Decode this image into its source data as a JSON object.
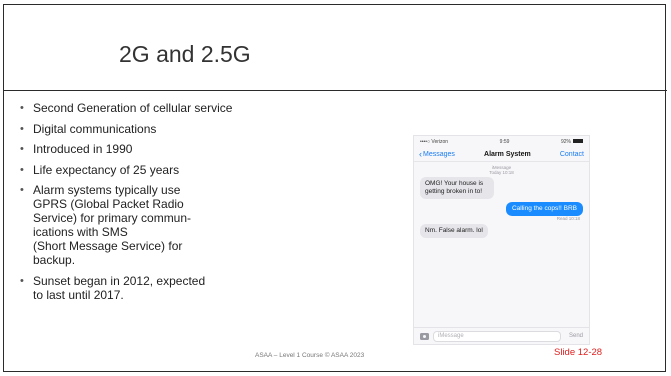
{
  "slide": {
    "title": "2G and 2.5G",
    "bullets": [
      "Second Generation of cellular service",
      "Digital communications",
      "Introduced in 1990",
      "Life expectancy of 25 years",
      "Alarm systems typically use\nGPRS (Global Packet Radio\nService) for primary commun-\nications with SMS\n(Short Message Service) for\nbackup.",
      "Sunset began in 2012, expected\nto last until 2017."
    ],
    "footer": "ASAA – Level 1 Course © ASAA 2023",
    "slide_number": "Slide 12-28",
    "colors": {
      "slide_number": "#e02020",
      "imessage_blue": "#1a8cff",
      "ios_link": "#1a7bf2"
    }
  },
  "phone": {
    "status": {
      "carrier": "••••○ Verizon",
      "time": "9:59",
      "battery": "92%"
    },
    "nav": {
      "back": "Messages",
      "name": "Alarm System",
      "action": "Contact"
    },
    "meta": {
      "service": "iMessage",
      "time": "Today 10:18"
    },
    "messages": [
      {
        "dir": "in",
        "text": "OMG! Your house is getting broken in to!"
      },
      {
        "dir": "out",
        "text": "Calling the cops!! BRB"
      },
      {
        "dir": "in",
        "text": "Nm. False alarm. lol"
      }
    ],
    "read_receipt": "Read 10:18",
    "composer": {
      "placeholder": "iMessage",
      "send": "Send"
    }
  }
}
